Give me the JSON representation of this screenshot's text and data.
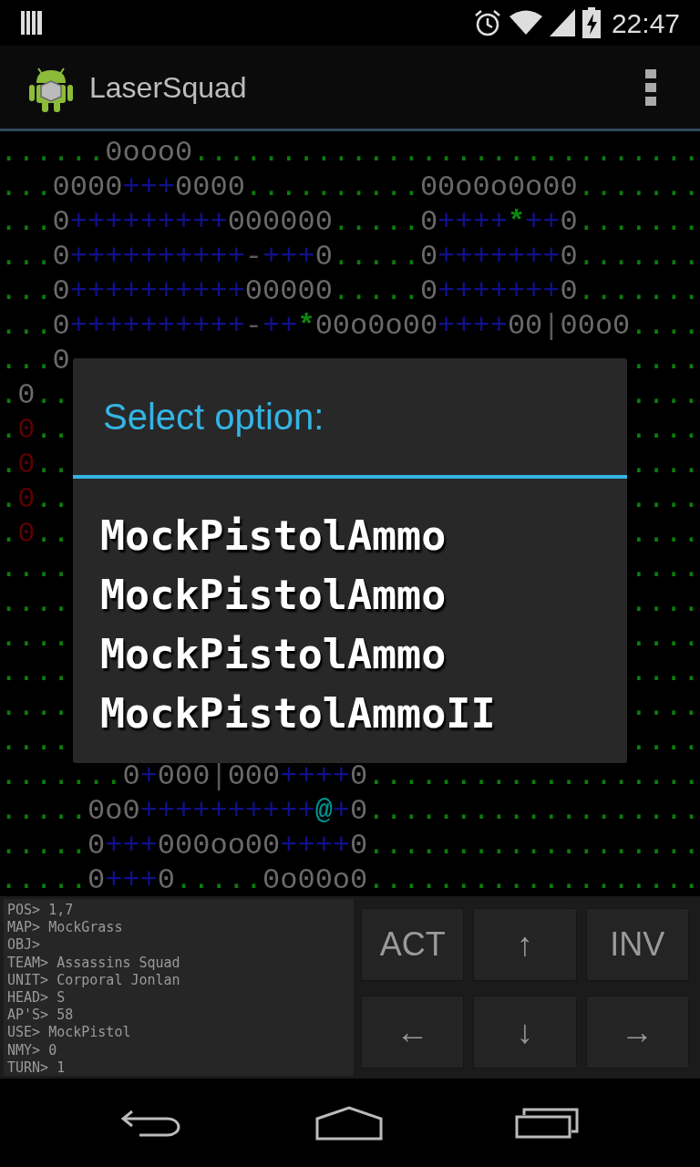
{
  "status_bar": {
    "time": "22:47"
  },
  "action_bar": {
    "title": "LaserSquad"
  },
  "map": {
    "rows": [
      {
        "segments": [
          {
            "kind": "grass",
            "text": "......"
          },
          {
            "kind": "wall",
            "text": "0ooo0"
          },
          {
            "kind": "grass",
            "text": "............................."
          }
        ]
      },
      {
        "segments": [
          {
            "kind": "grass",
            "text": "..."
          },
          {
            "kind": "wall",
            "text": "0000"
          },
          {
            "kind": "floor",
            "text": "+++"
          },
          {
            "kind": "wall",
            "text": "0000"
          },
          {
            "kind": "grass",
            "text": ".........."
          },
          {
            "kind": "wall",
            "text": "00o0o0o00"
          },
          {
            "kind": "grass",
            "text": "......."
          }
        ]
      },
      {
        "segments": [
          {
            "kind": "grass",
            "text": "..."
          },
          {
            "kind": "wall",
            "text": "0"
          },
          {
            "kind": "floor",
            "text": "+++++++++"
          },
          {
            "kind": "wall",
            "text": "000000"
          },
          {
            "kind": "grass",
            "text": "....."
          },
          {
            "kind": "wall",
            "text": "0"
          },
          {
            "kind": "floor",
            "text": "++++"
          },
          {
            "kind": "tree",
            "text": "*"
          },
          {
            "kind": "floor",
            "text": "++"
          },
          {
            "kind": "wall",
            "text": "0"
          },
          {
            "kind": "grass",
            "text": "......."
          }
        ]
      },
      {
        "segments": [
          {
            "kind": "grass",
            "text": "..."
          },
          {
            "kind": "wall",
            "text": "0"
          },
          {
            "kind": "floor",
            "text": "++++++++++"
          },
          {
            "kind": "door",
            "text": "-"
          },
          {
            "kind": "floor",
            "text": "+++"
          },
          {
            "kind": "wall",
            "text": "0"
          },
          {
            "kind": "grass",
            "text": "....."
          },
          {
            "kind": "wall",
            "text": "0"
          },
          {
            "kind": "floor",
            "text": "+++++++"
          },
          {
            "kind": "wall",
            "text": "0"
          },
          {
            "kind": "grass",
            "text": "......."
          }
        ]
      },
      {
        "segments": [
          {
            "kind": "grass",
            "text": "..."
          },
          {
            "kind": "wall",
            "text": "0"
          },
          {
            "kind": "floor",
            "text": "++++++++++"
          },
          {
            "kind": "wall",
            "text": "00000"
          },
          {
            "kind": "grass",
            "text": "....."
          },
          {
            "kind": "wall",
            "text": "0"
          },
          {
            "kind": "floor",
            "text": "+++++++"
          },
          {
            "kind": "wall",
            "text": "0"
          },
          {
            "kind": "grass",
            "text": "......."
          }
        ]
      },
      {
        "segments": [
          {
            "kind": "grass",
            "text": "..."
          },
          {
            "kind": "wall",
            "text": "0"
          },
          {
            "kind": "floor",
            "text": "++++++++++"
          },
          {
            "kind": "door",
            "text": "-"
          },
          {
            "kind": "floor",
            "text": "++"
          },
          {
            "kind": "tree",
            "text": "*"
          },
          {
            "kind": "wall",
            "text": "00o0o00"
          },
          {
            "kind": "floor",
            "text": "++++"
          },
          {
            "kind": "wall",
            "text": "00"
          },
          {
            "kind": "door",
            "text": "|"
          },
          {
            "kind": "wall",
            "text": "00o0"
          },
          {
            "kind": "grass",
            "text": "...."
          }
        ]
      },
      {
        "left": [
          {
            "kind": "grass",
            "text": "..."
          },
          {
            "kind": "wall",
            "text": "0"
          }
        ],
        "right": [
          {
            "kind": "grass",
            "text": "...."
          }
        ]
      },
      {
        "left": [
          {
            "kind": "grass",
            "text": "."
          },
          {
            "kind": "wall",
            "text": "0"
          },
          {
            "kind": "grass",
            "text": ".."
          }
        ],
        "right": [
          {
            "kind": "grass",
            "text": "...."
          }
        ]
      },
      {
        "left": [
          {
            "kind": "grass",
            "text": "."
          },
          {
            "kind": "enemy",
            "text": "0"
          },
          {
            "kind": "grass",
            "text": ".."
          }
        ],
        "right": [
          {
            "kind": "grass",
            "text": "...."
          }
        ]
      },
      {
        "left": [
          {
            "kind": "grass",
            "text": "."
          },
          {
            "kind": "enemy",
            "text": "0"
          },
          {
            "kind": "grass",
            "text": ".."
          }
        ],
        "right": [
          {
            "kind": "grass",
            "text": "...."
          }
        ]
      },
      {
        "left": [
          {
            "kind": "grass",
            "text": "."
          },
          {
            "kind": "enemy",
            "text": "0"
          },
          {
            "kind": "grass",
            "text": ".."
          }
        ],
        "right": [
          {
            "kind": "grass",
            "text": "...."
          }
        ]
      },
      {
        "left": [
          {
            "kind": "grass",
            "text": "."
          },
          {
            "kind": "enemy",
            "text": "0"
          },
          {
            "kind": "grass",
            "text": ".."
          }
        ],
        "right": [
          {
            "kind": "grass",
            "text": "...."
          }
        ]
      },
      {
        "left": [
          {
            "kind": "grass",
            "text": "...."
          }
        ],
        "right": [
          {
            "kind": "grass",
            "text": "...."
          }
        ]
      },
      {
        "left": [
          {
            "kind": "grass",
            "text": "...."
          }
        ],
        "right": [
          {
            "kind": "grass",
            "text": "...."
          }
        ]
      },
      {
        "left": [
          {
            "kind": "grass",
            "text": "...."
          }
        ],
        "right": [
          {
            "kind": "grass",
            "text": "...."
          }
        ]
      },
      {
        "left": [
          {
            "kind": "grass",
            "text": "...."
          }
        ],
        "right": [
          {
            "kind": "grass",
            "text": "...."
          }
        ]
      },
      {
        "left": [
          {
            "kind": "grass",
            "text": "...."
          }
        ],
        "right": [
          {
            "kind": "grass",
            "text": "...."
          }
        ]
      },
      {
        "left": [
          {
            "kind": "grass",
            "text": "...."
          }
        ],
        "right": [
          {
            "kind": "grass",
            "text": "...."
          }
        ]
      },
      {
        "segments": [
          {
            "kind": "grass",
            "text": "......."
          },
          {
            "kind": "wall",
            "text": "0"
          },
          {
            "kind": "floor",
            "text": "+"
          },
          {
            "kind": "wall",
            "text": "000"
          },
          {
            "kind": "door",
            "text": "|"
          },
          {
            "kind": "wall",
            "text": "000"
          },
          {
            "kind": "floor",
            "text": "++++"
          },
          {
            "kind": "wall",
            "text": "0"
          },
          {
            "kind": "grass",
            "text": "..................."
          }
        ]
      },
      {
        "segments": [
          {
            "kind": "grass",
            "text": "....."
          },
          {
            "kind": "wall",
            "text": "0o0"
          },
          {
            "kind": "floor",
            "text": "++++++++++"
          },
          {
            "kind": "unit",
            "text": "@"
          },
          {
            "kind": "floor",
            "text": "+"
          },
          {
            "kind": "wall",
            "text": "0"
          },
          {
            "kind": "grass",
            "text": "..................."
          }
        ]
      },
      {
        "segments": [
          {
            "kind": "grass",
            "text": "....."
          },
          {
            "kind": "wall",
            "text": "0"
          },
          {
            "kind": "floor",
            "text": "+++"
          },
          {
            "kind": "wall",
            "text": "000oo00"
          },
          {
            "kind": "floor",
            "text": "++++"
          },
          {
            "kind": "wall",
            "text": "0"
          },
          {
            "kind": "grass",
            "text": "..................."
          }
        ]
      },
      {
        "segments": [
          {
            "kind": "grass",
            "text": "....."
          },
          {
            "kind": "wall",
            "text": "0"
          },
          {
            "kind": "floor",
            "text": "+++"
          },
          {
            "kind": "wall",
            "text": "0"
          },
          {
            "kind": "grass",
            "text": "....."
          },
          {
            "kind": "wall",
            "text": "0o00o0"
          },
          {
            "kind": "grass",
            "text": "..................."
          }
        ]
      }
    ]
  },
  "dialog": {
    "title": "Select option:",
    "options": [
      "MockPistolAmmo",
      "MockPistolAmmo",
      "MockPistolAmmo",
      "MockPistolAmmoII"
    ]
  },
  "info_panel": {
    "lines": [
      "POS> 1,7",
      "MAP> MockGrass",
      "OBJ>",
      "TEAM> Assassins Squad",
      "UNIT> Corporal Jonlan",
      "HEAD> S",
      "AP'S> 58",
      "USE> MockPistol",
      "NMY> 0",
      "TURN> 1"
    ]
  },
  "controls": [
    {
      "label": "ACT"
    },
    {
      "label": "↑"
    },
    {
      "label": "INV"
    },
    {
      "label": "←"
    },
    {
      "label": "↓"
    },
    {
      "label": "→"
    }
  ]
}
